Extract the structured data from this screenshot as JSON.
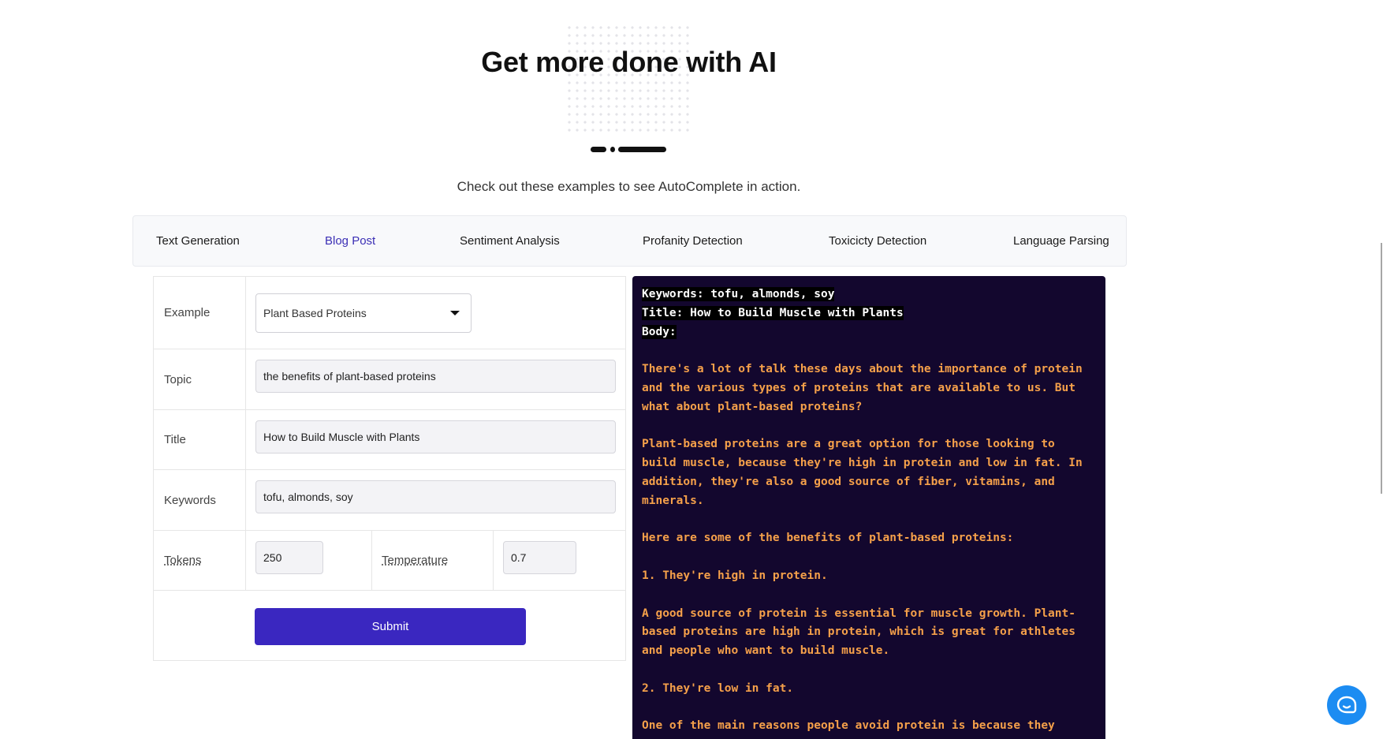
{
  "header": {
    "title": "Get more done with AI",
    "subtitle": "Check out these examples to see AutoComplete in action."
  },
  "tabs": [
    {
      "label": "Text Generation",
      "active": false
    },
    {
      "label": "Blog Post",
      "active": true
    },
    {
      "label": "Sentiment Analysis",
      "active": false
    },
    {
      "label": "Profanity Detection",
      "active": false
    },
    {
      "label": "Toxicicty Detection",
      "active": false
    },
    {
      "label": "Language Parsing",
      "active": false
    }
  ],
  "form": {
    "example_label": "Example",
    "example_value": "Plant Based Proteins",
    "topic_label": "Topic",
    "topic_value": "the benefits of plant-based proteins",
    "title_label": "Title",
    "title_value": "How to Build Muscle with Plants",
    "keywords_label": "Keywords",
    "keywords_value": "tofu, almonds, soy",
    "tokens_label": "Tokens",
    "tokens_value": "250",
    "temperature_label": "Temperature",
    "temperature_value": "0.7",
    "submit_label": "Submit"
  },
  "output": {
    "prompt_lines": [
      "Keywords: tofu, almonds, soy",
      "Title: How to Build Muscle with Plants",
      "Body:"
    ],
    "generated": "There's a lot of talk these days about the importance of protein and the various types of proteins that are available to us. But what about plant-based proteins?\n\nPlant-based proteins are a great option for those looking to build muscle, because they're high in protein and low in fat. In addition, they're also a good source of fiber, vitamins, and minerals.\n\nHere are some of the benefits of plant-based proteins:\n\n1. They're high in protein.\n\nA good source of protein is essential for muscle growth. Plant-based proteins are high in protein, which is great for athletes and people who want to build muscle.\n\n2. They're low in fat.\n\nOne of the main reasons people avoid protein is because they"
  },
  "colors": {
    "accent": "#3a27c0",
    "active_tab": "#3b2fb5",
    "output_bg": "#13072e",
    "generated_text": "#f5a04a",
    "chat_button": "#1c8cf2"
  },
  "icons": {
    "dropdown": "chevron-down-icon",
    "chat": "chat-bubble-icon"
  }
}
